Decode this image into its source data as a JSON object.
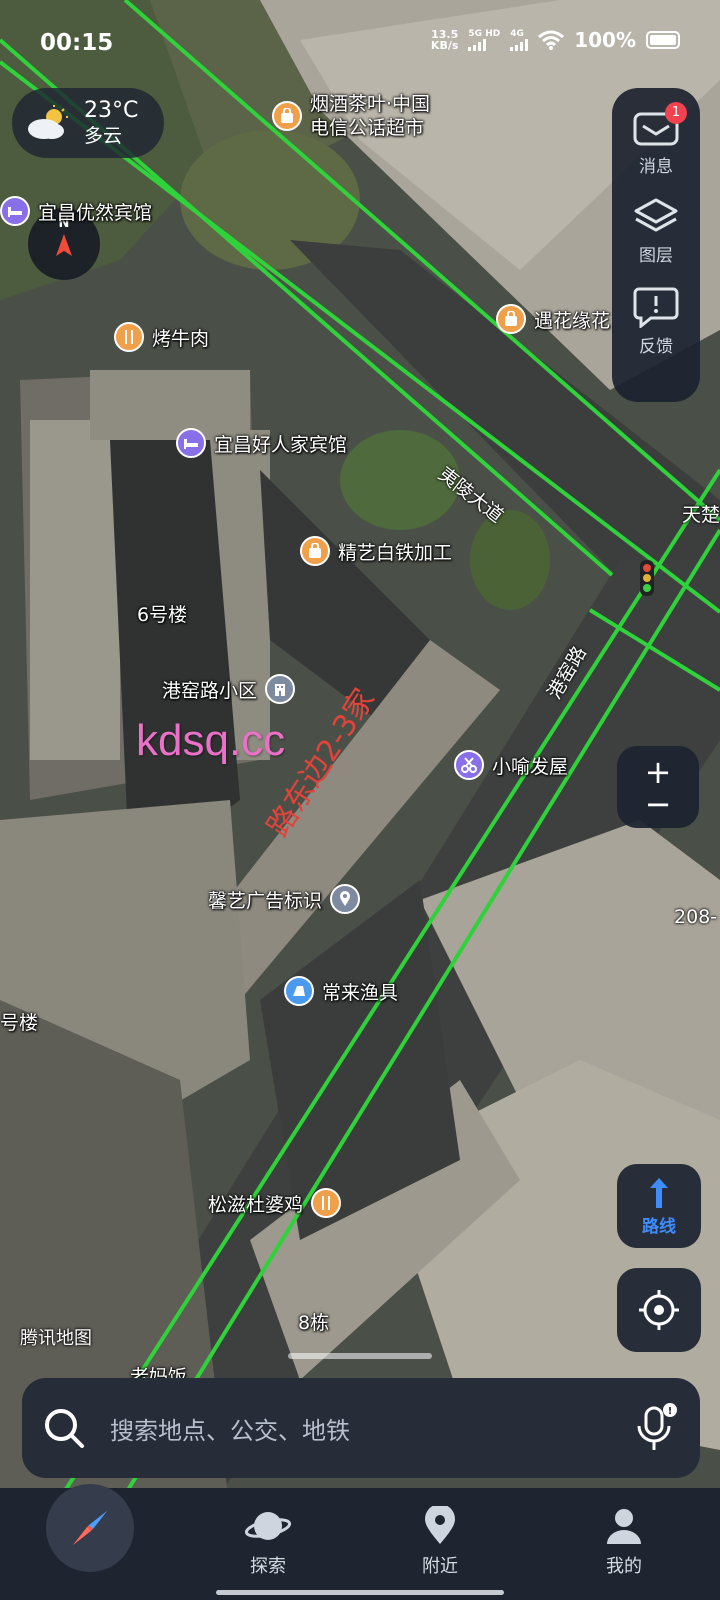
{
  "status_bar": {
    "time": "00:15",
    "net_speed_value": "13.5",
    "net_speed_unit": "KB/s",
    "sim1_label": "5G HD",
    "sim2_label": "4G",
    "battery": "100%"
  },
  "weather": {
    "temperature": "23°C",
    "condition": "多云",
    "icon": "partly-cloudy-icon"
  },
  "compass": {
    "north_label": "N"
  },
  "right_panel": {
    "message": {
      "label": "消息",
      "badge": "1"
    },
    "layers": {
      "label": "图层"
    },
    "feedback": {
      "label": "反馈"
    }
  },
  "zoom": {
    "in": "+",
    "out": "−"
  },
  "route_button": {
    "label": "路线"
  },
  "map_labels": {
    "poi_tobacco": "烟酒茶叶·中国\n电信公话超市",
    "poi_hotel_youran": "宜昌优然宾馆",
    "poi_bbq": "烤牛肉",
    "poi_hotel_haoren": "宜昌好人家宾馆",
    "poi_yuhua": "遇花缘花",
    "poi_jingyi": "精艺白铁加工",
    "poi_xiaoyu": "小喻发屋",
    "poi_xinyi": "馨艺广告标识",
    "poi_changlai": "常来渔具",
    "poi_songzi": "松滋杜婆鸡",
    "poi_bottom": "老妈饭",
    "community": "港窑路小区",
    "building_6": "6号楼",
    "building_8": "8栋",
    "building_left": "号楼",
    "road_yiling": "夷陵大道",
    "road_gangyao": "港窑路",
    "road_tianchu": "天楚",
    "address_208": "208-"
  },
  "watermark": "kdsq.cc",
  "annotation": "路东边2-3家",
  "brand": "腾讯地图",
  "search": {
    "placeholder": "搜索地点、公交、地铁"
  },
  "bottom_nav": {
    "explore": "探索",
    "nearby": "附近",
    "mine": "我的"
  },
  "colors": {
    "panel_bg": "#1c2330",
    "route_blue": "#3f8cff",
    "road_green": "#2fd23a",
    "badge_red": "#f0424f",
    "watermark_pink": "#ea70c8",
    "annotation_red": "#e0443a"
  }
}
